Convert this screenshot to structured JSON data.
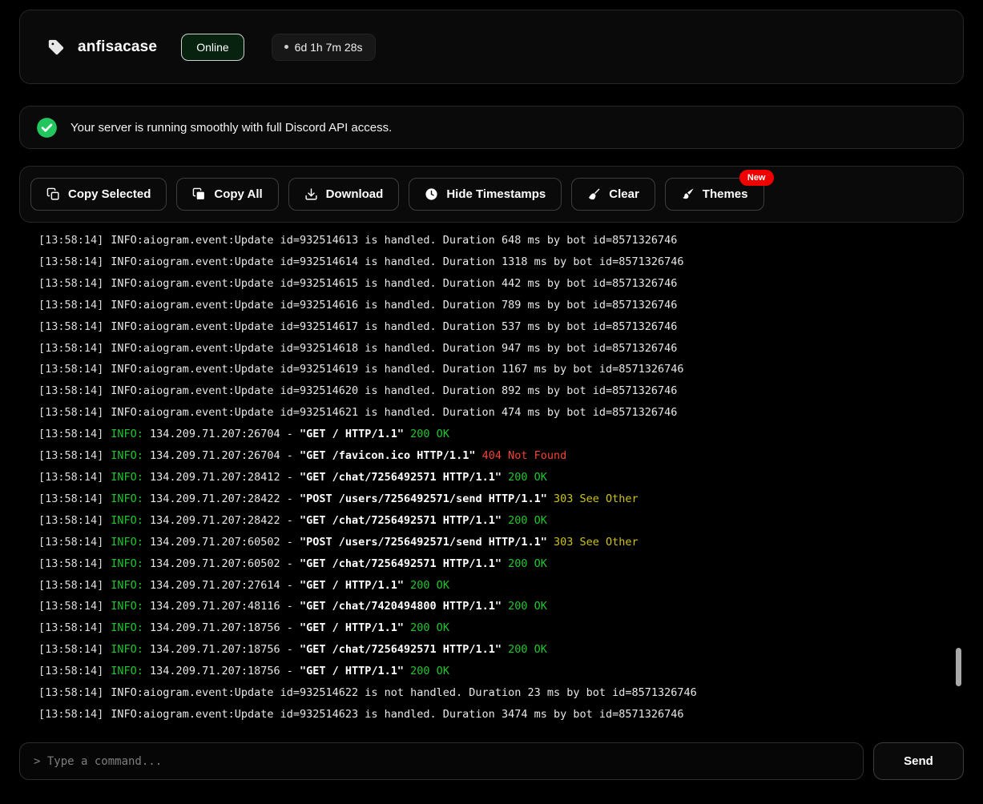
{
  "header": {
    "title": "anfisacase",
    "status": "Online",
    "uptime": "6d 1h 7m 28s"
  },
  "banner": {
    "message": "Your server is running smoothly with full Discord API access."
  },
  "toolbar": {
    "buttons": [
      {
        "label": "Copy Selected",
        "icon": "copy-icon"
      },
      {
        "label": "Copy All",
        "icon": "copy-all-icon"
      },
      {
        "label": "Download",
        "icon": "download-icon"
      },
      {
        "label": "Hide Timestamps",
        "icon": "clock-icon"
      },
      {
        "label": "Clear",
        "icon": "broom-icon"
      },
      {
        "label": "Themes",
        "icon": "brush-icon",
        "badge": "New"
      }
    ]
  },
  "colors": {
    "success_green": "#1fc72e",
    "error_red": "#f44336",
    "redirect_yellow": "#cdc413",
    "new_badge_red": "#f10000",
    "status_circle_green": "#22c55e"
  },
  "console": {
    "lines": [
      {
        "t": "[13:58:14]",
        "parts": [
          {
            "text": "INFO:aiogram.event:Update id=932514613 is handled. Duration 648 ms by bot id=8571326746",
            "style": "plain"
          }
        ]
      },
      {
        "t": "[13:58:14]",
        "parts": [
          {
            "text": "INFO:aiogram.event:Update id=932514614 is handled. Duration 1318 ms by bot id=8571326746",
            "style": "plain"
          }
        ]
      },
      {
        "t": "[13:58:14]",
        "parts": [
          {
            "text": "INFO:aiogram.event:Update id=932514615 is handled. Duration 442 ms by bot id=8571326746",
            "style": "plain"
          }
        ]
      },
      {
        "t": "[13:58:14]",
        "parts": [
          {
            "text": "INFO:aiogram.event:Update id=932514616 is handled. Duration 789 ms by bot id=8571326746",
            "style": "plain"
          }
        ]
      },
      {
        "t": "[13:58:14]",
        "parts": [
          {
            "text": "INFO:aiogram.event:Update id=932514617 is handled. Duration 537 ms by bot id=8571326746",
            "style": "plain"
          }
        ]
      },
      {
        "t": "[13:58:14]",
        "parts": [
          {
            "text": "INFO:aiogram.event:Update id=932514618 is handled. Duration 947 ms by bot id=8571326746",
            "style": "plain"
          }
        ]
      },
      {
        "t": "[13:58:14]",
        "parts": [
          {
            "text": "INFO:aiogram.event:Update id=932514619 is handled. Duration 1167 ms by bot id=8571326746",
            "style": "plain"
          }
        ]
      },
      {
        "t": "[13:58:14]",
        "parts": [
          {
            "text": "INFO:aiogram.event:Update id=932514620 is handled. Duration 892 ms by bot id=8571326746",
            "style": "plain"
          }
        ]
      },
      {
        "t": "[13:58:14]",
        "parts": [
          {
            "text": "INFO:aiogram.event:Update id=932514621 is handled. Duration 474 ms by bot id=8571326746",
            "style": "plain"
          }
        ]
      },
      {
        "t": "[13:58:14]",
        "parts": [
          {
            "text": "INFO:",
            "style": "green"
          },
          {
            "text": " 134.209.71.207:26704 - ",
            "style": "plain"
          },
          {
            "text": "\"GET / HTTP/1.1\"",
            "style": "bold"
          },
          {
            "text": " 200 OK",
            "style": "green"
          }
        ]
      },
      {
        "t": "[13:58:14]",
        "parts": [
          {
            "text": "INFO:",
            "style": "green"
          },
          {
            "text": " 134.209.71.207:26704 - ",
            "style": "plain"
          },
          {
            "text": "\"GET /favicon.ico HTTP/1.1\"",
            "style": "bold"
          },
          {
            "text": " 404 Not Found",
            "style": "red"
          }
        ]
      },
      {
        "t": "[13:58:14]",
        "parts": [
          {
            "text": "INFO:",
            "style": "green"
          },
          {
            "text": " 134.209.71.207:28412 - ",
            "style": "plain"
          },
          {
            "text": "\"GET /chat/7256492571 HTTP/1.1\"",
            "style": "bold"
          },
          {
            "text": " 200 OK",
            "style": "green"
          }
        ]
      },
      {
        "t": "[13:58:14]",
        "parts": [
          {
            "text": "INFO:",
            "style": "green"
          },
          {
            "text": " 134.209.71.207:28422 - ",
            "style": "plain"
          },
          {
            "text": "\"POST /users/7256492571/send HTTP/1.1\"",
            "style": "bold"
          },
          {
            "text": " 303 See Other",
            "style": "yellow"
          }
        ]
      },
      {
        "t": "[13:58:14]",
        "parts": [
          {
            "text": "INFO:",
            "style": "green"
          },
          {
            "text": " 134.209.71.207:28422 - ",
            "style": "plain"
          },
          {
            "text": "\"GET /chat/7256492571 HTTP/1.1\"",
            "style": "bold"
          },
          {
            "text": " 200 OK",
            "style": "green"
          }
        ]
      },
      {
        "t": "[13:58:14]",
        "parts": [
          {
            "text": "INFO:",
            "style": "green"
          },
          {
            "text": " 134.209.71.207:60502 - ",
            "style": "plain"
          },
          {
            "text": "\"POST /users/7256492571/send HTTP/1.1\"",
            "style": "bold"
          },
          {
            "text": " 303 See Other",
            "style": "yellow"
          }
        ]
      },
      {
        "t": "[13:58:14]",
        "parts": [
          {
            "text": "INFO:",
            "style": "green"
          },
          {
            "text": " 134.209.71.207:60502 - ",
            "style": "plain"
          },
          {
            "text": "\"GET /chat/7256492571 HTTP/1.1\"",
            "style": "bold"
          },
          {
            "text": " 200 OK",
            "style": "green"
          }
        ]
      },
      {
        "t": "[13:58:14]",
        "parts": [
          {
            "text": "INFO:",
            "style": "green"
          },
          {
            "text": " 134.209.71.207:27614 - ",
            "style": "plain"
          },
          {
            "text": "\"GET / HTTP/1.1\"",
            "style": "bold"
          },
          {
            "text": " 200 OK",
            "style": "green"
          }
        ]
      },
      {
        "t": "[13:58:14]",
        "parts": [
          {
            "text": "INFO:",
            "style": "green"
          },
          {
            "text": " 134.209.71.207:48116 - ",
            "style": "plain"
          },
          {
            "text": "\"GET /chat/7420494800 HTTP/1.1\"",
            "style": "bold"
          },
          {
            "text": " 200 OK",
            "style": "green"
          }
        ]
      },
      {
        "t": "[13:58:14]",
        "parts": [
          {
            "text": "INFO:",
            "style": "green"
          },
          {
            "text": " 134.209.71.207:18756 - ",
            "style": "plain"
          },
          {
            "text": "\"GET / HTTP/1.1\"",
            "style": "bold"
          },
          {
            "text": " 200 OK",
            "style": "green"
          }
        ]
      },
      {
        "t": "[13:58:14]",
        "parts": [
          {
            "text": "INFO:",
            "style": "green"
          },
          {
            "text": " 134.209.71.207:18756 - ",
            "style": "plain"
          },
          {
            "text": "\"GET /chat/7256492571 HTTP/1.1\"",
            "style": "bold"
          },
          {
            "text": " 200 OK",
            "style": "green"
          }
        ]
      },
      {
        "t": "[13:58:14]",
        "parts": [
          {
            "text": "INFO:",
            "style": "green"
          },
          {
            "text": " 134.209.71.207:18756 - ",
            "style": "plain"
          },
          {
            "text": "\"GET / HTTP/1.1\"",
            "style": "bold"
          },
          {
            "text": " 200 OK",
            "style": "green"
          }
        ]
      },
      {
        "t": "[13:58:14]",
        "parts": [
          {
            "text": "INFO:aiogram.event:Update id=932514622 is not handled. Duration 23 ms by bot id=8571326746",
            "style": "plain"
          }
        ]
      },
      {
        "t": "[13:58:14]",
        "parts": [
          {
            "text": "INFO:aiogram.event:Update id=932514623 is handled. Duration 3474 ms by bot id=8571326746",
            "style": "plain"
          }
        ]
      }
    ]
  },
  "input": {
    "placeholder": "> Type a command...",
    "send_label": "Send"
  }
}
